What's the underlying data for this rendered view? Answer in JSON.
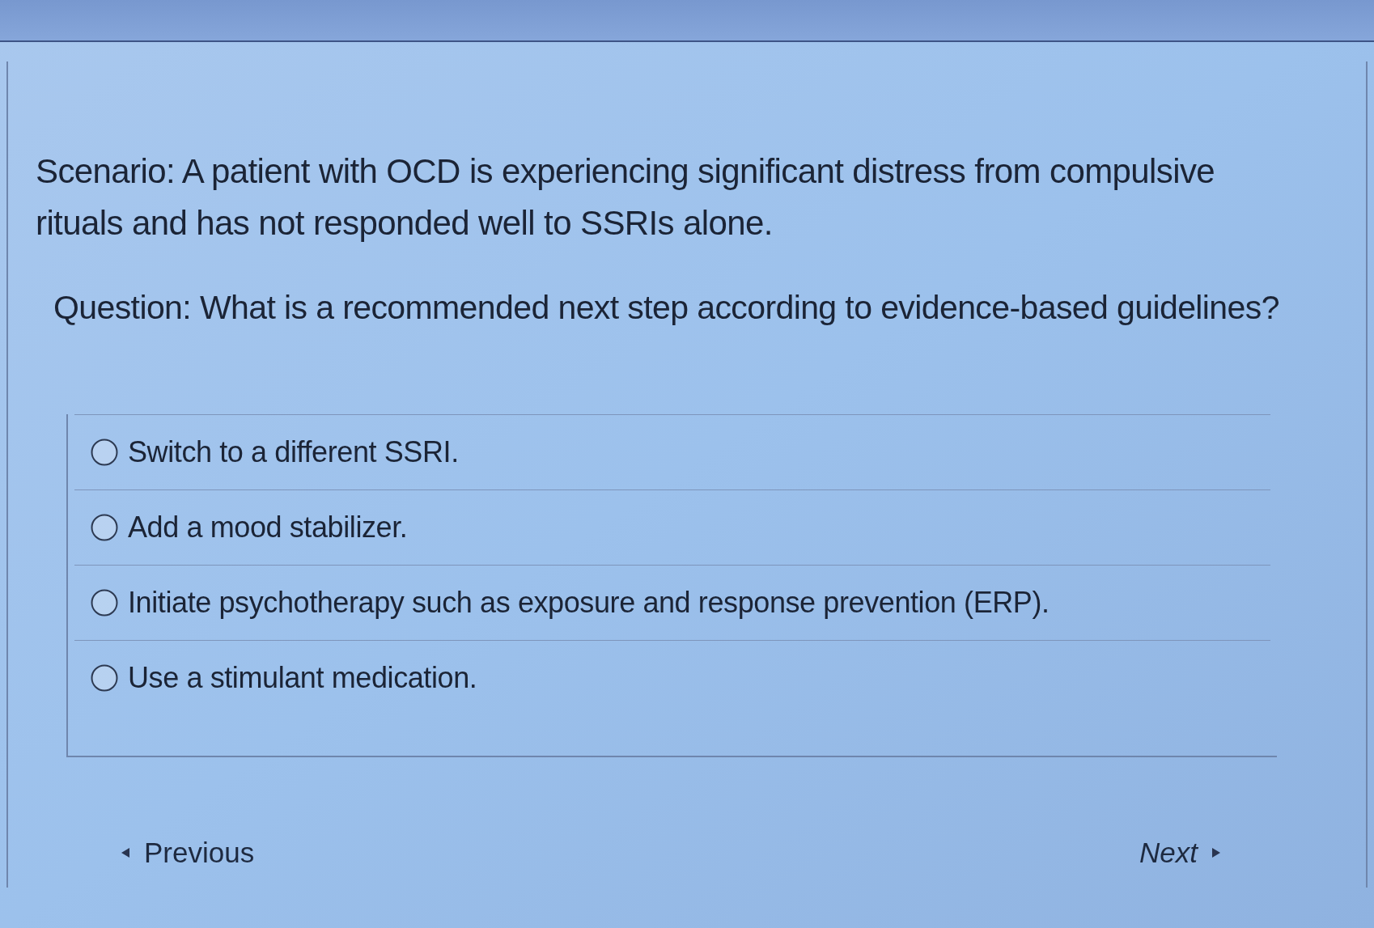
{
  "scenario": "Scenario: A patient with OCD is experiencing significant distress from compulsive rituals and has not responded well to SSRIs alone.",
  "question": "Question: What is a recommended next step according to evidence-based guidelines?",
  "options": [
    {
      "label": "Switch to a different SSRI.",
      "selected": false
    },
    {
      "label": "Add a mood stabilizer.",
      "selected": false
    },
    {
      "label": "Initiate psychotherapy such as exposure and response prevention (ERP).",
      "selected": false
    },
    {
      "label": "Use a stimulant medication.",
      "selected": false
    }
  ],
  "navigation": {
    "previous": "Previous",
    "next": "Next"
  }
}
